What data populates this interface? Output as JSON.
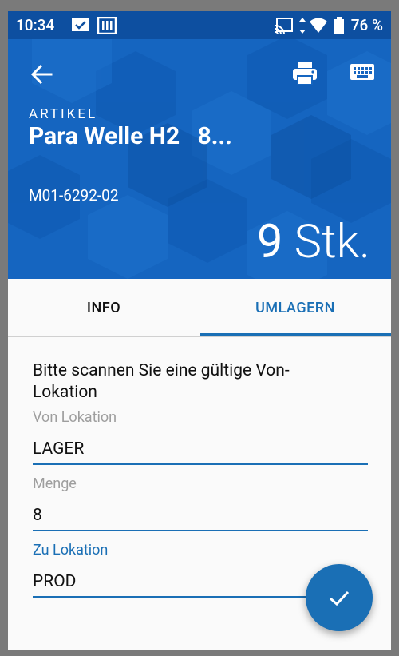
{
  "status_bar": {
    "time": "10:34",
    "battery_percent": "76 %",
    "icons": [
      "mail-check-icon",
      "sim-card-icon",
      "cast-icon",
      "data-arrows-icon",
      "wifi-icon",
      "battery-icon"
    ]
  },
  "header": {
    "section_label": "ARTIKEL",
    "title": "Para Welle H2   8...",
    "article_number": "M01-6292-02",
    "quantity_value": "9",
    "quantity_unit": "Stk.",
    "icons": [
      "back-arrow-icon",
      "print-icon",
      "keyboard-icon"
    ]
  },
  "tabs": [
    {
      "label": "INFO",
      "active": false
    },
    {
      "label": "UMLAGERN",
      "active": true
    }
  ],
  "form": {
    "prompt": "Bitte scannen Sie eine gültige Von-Lokation",
    "fields": [
      {
        "label": "Von Lokation",
        "value": "LAGER"
      },
      {
        "label": "Menge",
        "value": "8"
      },
      {
        "label": "Zu Lokation",
        "value": "PROD"
      }
    ]
  },
  "fab": {
    "icon": "check-icon"
  },
  "colors": {
    "primary": "#1565c0",
    "status_bar": "#0d4fa0",
    "accent": "#1a6fb5",
    "background": "#fafafa",
    "label_grey": "#9e9e9e"
  }
}
